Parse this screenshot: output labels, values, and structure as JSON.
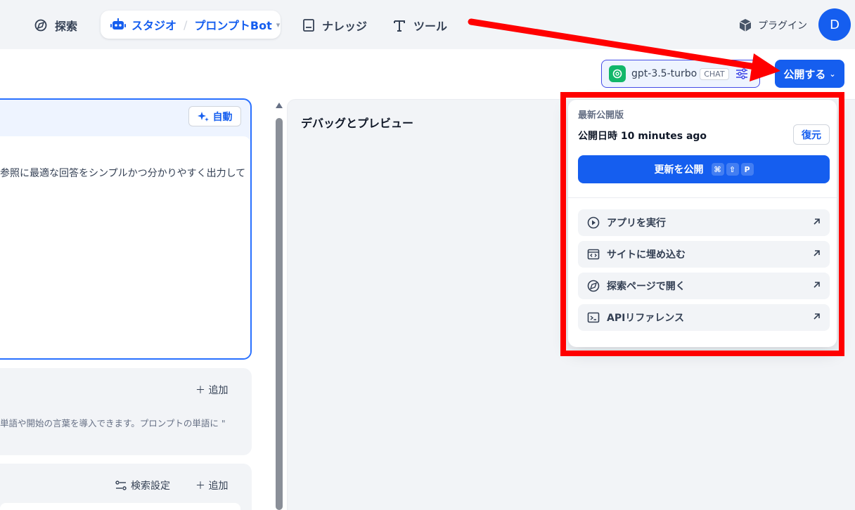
{
  "nav": {
    "explore": "探索",
    "studio": "スタジオ",
    "app_name": "プロンプトBot",
    "knowledge": "ナレッジ",
    "tools": "ツール",
    "plugins": "プラグイン",
    "avatar_initial": "D"
  },
  "model": {
    "name": "gpt-3.5-turbo",
    "badge": "CHAT"
  },
  "publish_button": "公開する",
  "editor": {
    "auto_label": "自動",
    "prompt_text": "参照に最適な回答をシンプルかつ分かりやすく出力して",
    "add_label": "追加",
    "vars_hint": "単語や開始の言葉を導入できます。プロンプトの単語に \"",
    "search_settings": "検索設定",
    "add_label_2": "追加"
  },
  "debug": {
    "title": "デバッグとプレビュー"
  },
  "publish_menu": {
    "latest_label": "最新公開版",
    "published_at": "公開日時 10 minutes ago",
    "restore": "復元",
    "update_publish": "更新を公開",
    "shortcut_keys": [
      "⌘",
      "⇧",
      "P"
    ],
    "items": [
      {
        "label": "アプリを実行",
        "icon": "play-circle-icon"
      },
      {
        "label": "サイトに埋め込む",
        "icon": "embed-code-icon"
      },
      {
        "label": "探索ページで開く",
        "icon": "compass-icon"
      },
      {
        "label": "APIリファレンス",
        "icon": "terminal-icon"
      }
    ]
  },
  "colors": {
    "accent": "#155eef",
    "annotation": "#ff0000",
    "model_logo": "#12b76a"
  }
}
